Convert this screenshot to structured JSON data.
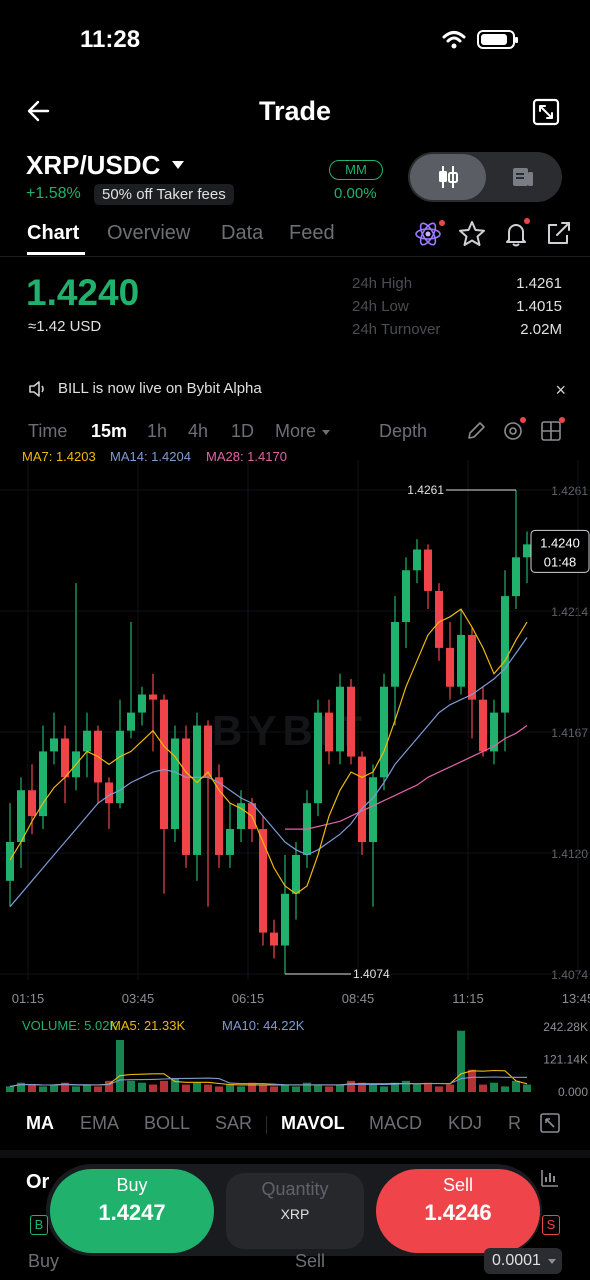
{
  "status_bar": {
    "time": "11:28"
  },
  "header": {
    "title": "Trade",
    "back_icon": "arrow-left-icon",
    "expand_icon": "expand-icon"
  },
  "pair": {
    "name": "XRP/USDC",
    "change": "+1.58%",
    "fee_badge": "50% off Taker fees",
    "mm_label": "MM",
    "mm_value": "0.00%"
  },
  "tabs": [
    "Chart",
    "Overview",
    "Data",
    "Feed"
  ],
  "price": {
    "last": "1.4240",
    "usd": "≈1.42 USD",
    "stats": [
      {
        "label": "24h High",
        "value": "1.4261"
      },
      {
        "label": "24h Low",
        "value": "1.4015"
      },
      {
        "label": "24h Turnover",
        "value": "2.02M"
      }
    ]
  },
  "announcement": {
    "text": "BILL is now live on Bybit Alpha",
    "close": "×"
  },
  "intervals": [
    "Time",
    "15m",
    "1h",
    "4h",
    "1D",
    "More"
  ],
  "depth_label": "Depth",
  "ma_legend": [
    {
      "text": "MA7: 1.4203",
      "color": "#f0b90b"
    },
    {
      "text": "MA14: 1.4204",
      "color": "#7f9bd3"
    },
    {
      "text": "MA28: 1.4170",
      "color": "#e065a8"
    }
  ],
  "colors": {
    "up": "#20b26c",
    "down": "#ef454a",
    "ma7": "#f0b90b",
    "ma14": "#7f9bd3",
    "ma28": "#e065a8",
    "accent": "#20b26c"
  },
  "chart_data": {
    "type": "candlestick",
    "ylim": [
      1.4074,
      1.4261
    ],
    "y_ticks": [
      "1.4261",
      "1.4214",
      "1.4167",
      "1.4120",
      "1.4074"
    ],
    "x_ticks": [
      "01:15",
      "03:45",
      "06:15",
      "08:45",
      "11:15",
      "13:45"
    ],
    "high_label": "1.4261",
    "low_label": "1.4074",
    "current_price": "1.4240",
    "countdown": "01:48",
    "candles": [
      [
        1.411,
        1.4125,
        1.414,
        1.41
      ],
      [
        1.4125,
        1.4145,
        1.415,
        1.4115
      ],
      [
        1.4145,
        1.4135,
        1.4155,
        1.4128
      ],
      [
        1.4135,
        1.416,
        1.417,
        1.413
      ],
      [
        1.416,
        1.4165,
        1.4175,
        1.4155
      ],
      [
        1.4165,
        1.415,
        1.417,
        1.414
      ],
      [
        1.415,
        1.416,
        1.4225,
        1.4145
      ],
      [
        1.416,
        1.4168,
        1.4175,
        1.415
      ],
      [
        1.4168,
        1.4148,
        1.417,
        1.414
      ],
      [
        1.4148,
        1.414,
        1.415,
        1.413
      ],
      [
        1.414,
        1.4168,
        1.418,
        1.4138
      ],
      [
        1.4168,
        1.4175,
        1.421,
        1.4165
      ],
      [
        1.4175,
        1.4182,
        1.4185,
        1.417
      ],
      [
        1.4182,
        1.418,
        1.419,
        1.416
      ],
      [
        1.418,
        1.413,
        1.4182,
        1.4105
      ],
      [
        1.413,
        1.4165,
        1.417,
        1.4125
      ],
      [
        1.4165,
        1.412,
        1.417,
        1.4115
      ],
      [
        1.412,
        1.417,
        1.4175,
        1.411
      ],
      [
        1.417,
        1.415,
        1.4172,
        1.41
      ],
      [
        1.415,
        1.412,
        1.4155,
        1.4115
      ],
      [
        1.412,
        1.413,
        1.414,
        1.4115
      ],
      [
        1.413,
        1.414,
        1.4145,
        1.4125
      ],
      [
        1.414,
        1.413,
        1.4142,
        1.4125
      ],
      [
        1.413,
        1.409,
        1.4135,
        1.4085
      ],
      [
        1.409,
        1.4085,
        1.4095,
        1.408
      ],
      [
        1.4085,
        1.4105,
        1.412,
        1.4074
      ],
      [
        1.4105,
        1.412,
        1.4125,
        1.4095
      ],
      [
        1.412,
        1.414,
        1.4145,
        1.4115
      ],
      [
        1.414,
        1.4175,
        1.418,
        1.4135
      ],
      [
        1.4175,
        1.416,
        1.418,
        1.4155
      ],
      [
        1.416,
        1.4185,
        1.419,
        1.4155
      ],
      [
        1.4185,
        1.4158,
        1.4188,
        1.4155
      ],
      [
        1.4158,
        1.4125,
        1.416,
        1.412
      ],
      [
        1.4125,
        1.415,
        1.4155,
        1.41
      ],
      [
        1.415,
        1.4185,
        1.419,
        1.4145
      ],
      [
        1.4185,
        1.421,
        1.422,
        1.417
      ],
      [
        1.421,
        1.423,
        1.4235,
        1.42
      ],
      [
        1.423,
        1.4238,
        1.4242,
        1.4225
      ],
      [
        1.4238,
        1.4222,
        1.424,
        1.4215
      ],
      [
        1.4222,
        1.42,
        1.4225,
        1.4195
      ],
      [
        1.42,
        1.4185,
        1.421,
        1.418
      ],
      [
        1.4185,
        1.4205,
        1.4215,
        1.4182
      ],
      [
        1.4205,
        1.418,
        1.4208,
        1.4165
      ],
      [
        1.418,
        1.416,
        1.4185,
        1.4158
      ],
      [
        1.416,
        1.4175,
        1.418,
        1.4155
      ],
      [
        1.4175,
        1.422,
        1.423,
        1.416
      ],
      [
        1.422,
        1.4235,
        1.4261,
        1.4215
      ],
      [
        1.4235,
        1.424,
        1.4245,
        1.4225
      ]
    ],
    "ma7": [
      1.4118,
      1.4125,
      1.4133,
      1.414,
      1.4146,
      1.415,
      1.4155,
      1.416,
      1.4158,
      1.4155,
      1.4158,
      1.416,
      1.4164,
      1.4168,
      1.4162,
      1.4158,
      1.4152,
      1.4148,
      1.4152,
      1.4145,
      1.414,
      1.4138,
      1.4135,
      1.4125,
      1.4115,
      1.4108,
      1.4105,
      1.4108,
      1.412,
      1.4135,
      1.4145,
      1.4152,
      1.415,
      1.4152,
      1.416,
      1.4172,
      1.4185,
      1.4195,
      1.4205,
      1.421,
      1.4212,
      1.4215,
      1.4208,
      1.42,
      1.419,
      1.4195,
      1.4203,
      1.421
    ],
    "ma14": [
      1.41,
      1.4105,
      1.411,
      1.4115,
      1.412,
      1.4125,
      1.413,
      1.4135,
      1.414,
      1.4143,
      1.4145,
      1.4148,
      1.415,
      1.4152,
      1.4153,
      1.4152,
      1.415,
      1.415,
      1.415,
      1.4148,
      1.4145,
      1.4142,
      1.414,
      1.4135,
      1.413,
      1.4125,
      1.4122,
      1.412,
      1.4122,
      1.4125,
      1.4128,
      1.4132,
      1.4138,
      1.4142,
      1.4148,
      1.4155,
      1.416,
      1.4165,
      1.417,
      1.4175,
      1.4178,
      1.418,
      1.4182,
      1.4185,
      1.4188,
      1.4192,
      1.4198,
      1.4204
    ],
    "ma28": [
      null,
      null,
      null,
      null,
      null,
      null,
      null,
      null,
      null,
      null,
      null,
      null,
      null,
      null,
      null,
      null,
      null,
      null,
      null,
      null,
      null,
      null,
      null,
      null,
      null,
      1.413,
      1.413,
      1.413,
      1.4131,
      1.4132,
      1.4133,
      1.4135,
      1.4137,
      1.4139,
      1.4141,
      1.4143,
      1.4145,
      1.4147,
      1.415,
      1.4152,
      1.4154,
      1.4156,
      1.4158,
      1.416,
      1.4162,
      1.4165,
      1.4167,
      1.417
    ],
    "volume_legend": [
      {
        "text": "VOLUME: 5.02K",
        "color": "#20b26c"
      },
      {
        "text": "MA5: 21.33K",
        "color": "#f0b90b"
      },
      {
        "text": "MA10: 44.22K",
        "color": "#7f9bd3"
      }
    ],
    "volume_ticks": [
      "242.28K",
      "121.14K",
      "0.000"
    ],
    "volumes": [
      3,
      5,
      4,
      3,
      4,
      5,
      3,
      4,
      3,
      6,
      28,
      6,
      5,
      4,
      6,
      7,
      4,
      5,
      4,
      3,
      4,
      3,
      5,
      4,
      3,
      4,
      3,
      5,
      4,
      3,
      4,
      6,
      5,
      4,
      3,
      5,
      6,
      4,
      5,
      3,
      4,
      33,
      12,
      4,
      5,
      3,
      6,
      4
    ],
    "ylabel": "",
    "xlabel": ""
  },
  "indicators": [
    "MA",
    "EMA",
    "BOLL",
    "SAR",
    "MAVOL",
    "MACD",
    "KDJ",
    "R"
  ],
  "bottom": {
    "order_tab_peek": "Or",
    "buy_label": "Buy",
    "buy_price": "1.4247",
    "quantity_label": "Quantity",
    "quantity_unit": "XRP",
    "sell_label": "Sell",
    "sell_price": "1.4246",
    "b_badge": "B",
    "s_badge": "S",
    "buy_col": "Buy",
    "sell_col": "Sell",
    "precision": "0.0001"
  }
}
